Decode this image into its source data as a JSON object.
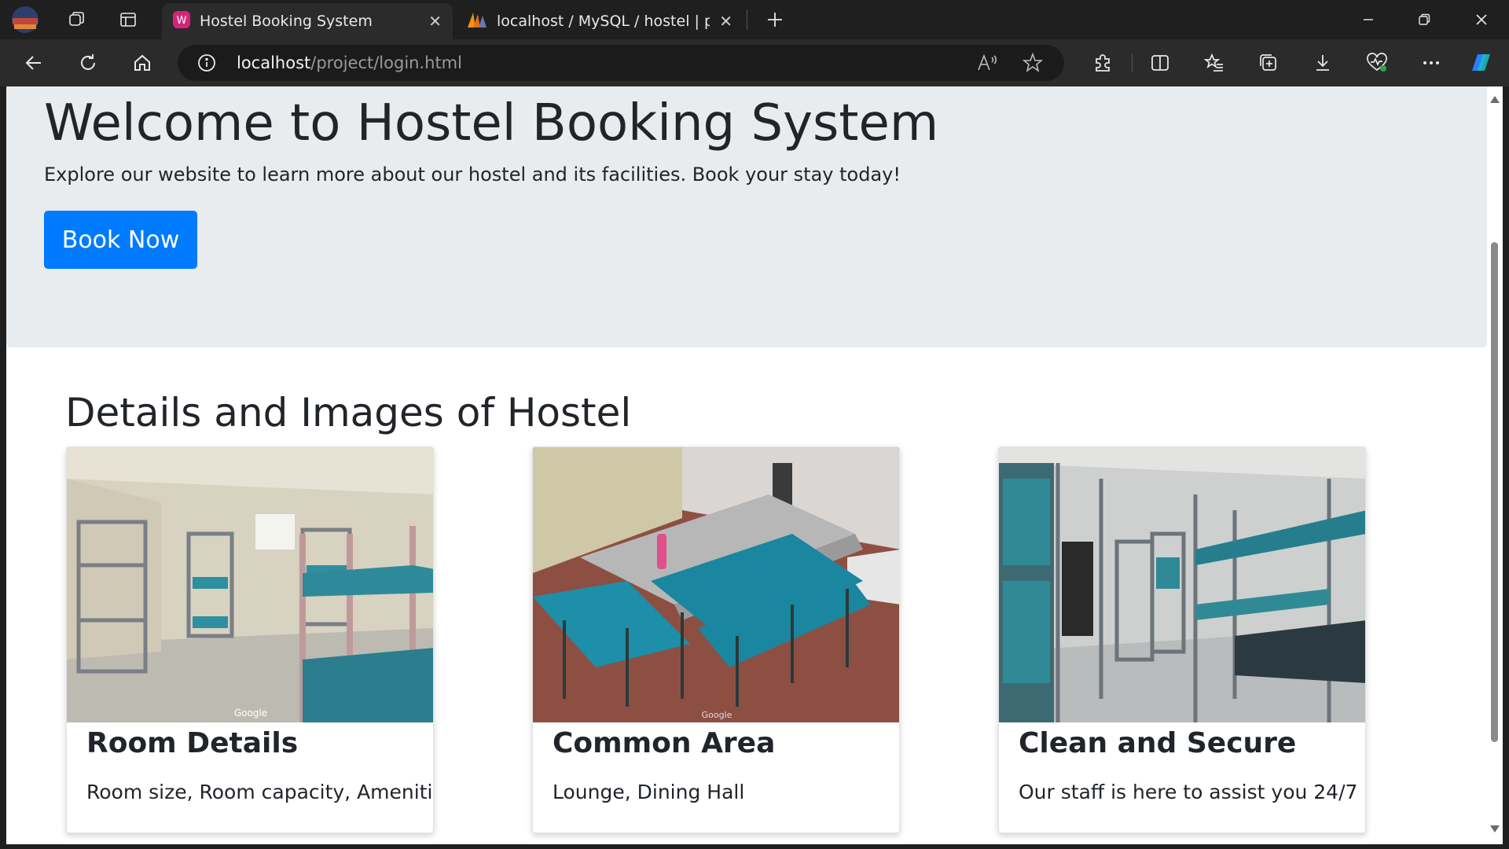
{
  "browser": {
    "tabs": [
      {
        "title": "Hostel Booking System",
        "active": true,
        "icon": "hostel-favicon"
      },
      {
        "title": "localhost / MySQL / hostel | phpMyAdmin",
        "active": false,
        "icon": "phpmyadmin-favicon"
      }
    ],
    "address": {
      "host": "localhost",
      "path": "/project/login.html"
    }
  },
  "page": {
    "hero": {
      "title": "Welcome to Hostel Booking System",
      "lead": "Explore our website to learn more about our hostel and its facilities. Book your stay today!",
      "button_label": "Book Now"
    },
    "section_title": "Details and Images of Hostel",
    "cards": [
      {
        "title": "Room Details",
        "text": "Room size, Room capacity, Amenities",
        "image": "hostel room with bunk beds",
        "watermark": "Google"
      },
      {
        "title": "Common Area",
        "text": "Lounge, Dining Hall",
        "image": "dining area with benches and steel tables",
        "watermark": "Google"
      },
      {
        "title": "Clean and Secure",
        "text": "Our staff is here to assist you 24/7",
        "image": "dormitory with bunk beds and lockers"
      }
    ]
  },
  "colors": {
    "accent": "#007bff",
    "hero_bg": "#e9ecef",
    "text": "#212529",
    "chrome_bg": "#1f1f1f",
    "toolbar_bg": "#2b2b2b"
  }
}
